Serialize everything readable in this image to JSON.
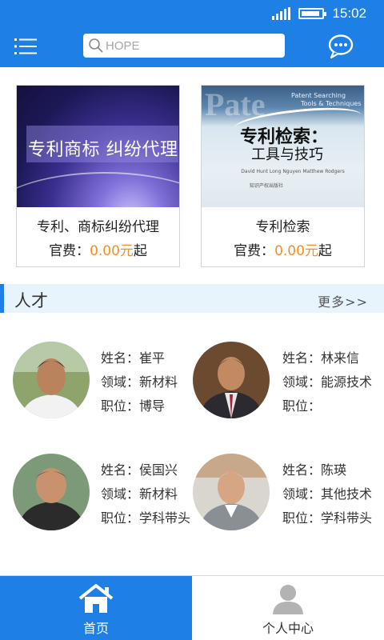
{
  "status_bar": {
    "time": "15:02"
  },
  "header": {
    "search_placeholder": "HOPE"
  },
  "cards": [
    {
      "image_text": "专利商标 纠纷代理",
      "title": "专利、商标纠纷代理",
      "fee_label": "官费：",
      "fee_amount": "0.00元",
      "fee_suffix": "起"
    },
    {
      "image_big": "Pate",
      "image_sub1": "Patent Searching",
      "image_sub2": "Tools & Techniques",
      "image_title1": "专利检索：",
      "image_title2": "工具与技巧",
      "image_authors": "David Hunt  Long Nguyen  Matthew Rodgers",
      "image_pub": "知识产权出版社",
      "title": "专利检索",
      "fee_label": "官费：",
      "fee_amount": "0.00元",
      "fee_suffix": "起"
    }
  ],
  "section": {
    "title": "人才",
    "more": "更多>>"
  },
  "talents": [
    {
      "name_label": "姓名：",
      "name": "崔平",
      "field_label": "领域：",
      "field": "新材料",
      "position_label": "职位：",
      "position": "博导"
    },
    {
      "name_label": "姓名：",
      "name": "林来信",
      "field_label": "领域：",
      "field": "能源技术",
      "position_label": "职位：",
      "position": ""
    },
    {
      "name_label": "姓名：",
      "name": "侯国兴",
      "field_label": "领域：",
      "field": "新材料",
      "position_label": "职位：",
      "position": "学科带头"
    },
    {
      "name_label": "姓名：",
      "name": "陈瑛",
      "field_label": "领域：",
      "field": "其他技术",
      "position_label": "职位：",
      "position": "学科带头"
    }
  ],
  "bottom_nav": {
    "home": "首页",
    "profile": "个人中心"
  },
  "colors": {
    "primary": "#1e7fe4",
    "accent_orange": "#ff8c1a",
    "section_bg": "#e8f4fc"
  }
}
